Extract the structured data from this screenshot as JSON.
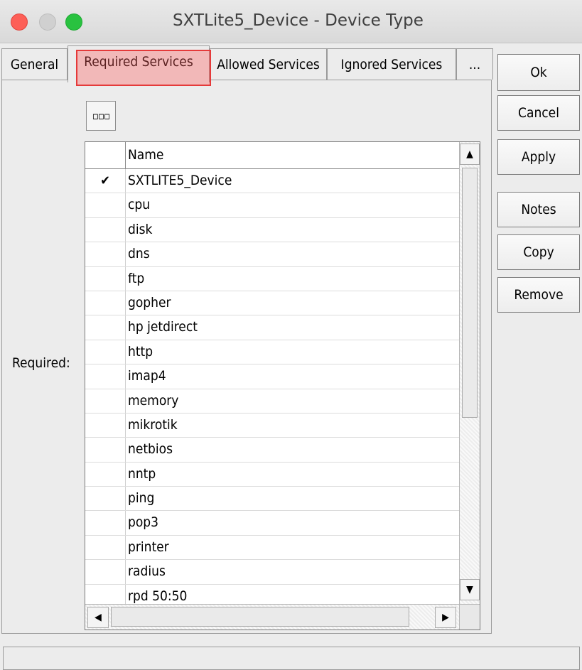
{
  "window": {
    "title": "SXTLite5_Device - Device Type"
  },
  "tabs": [
    {
      "label": "General"
    },
    {
      "label": "Required Services",
      "active": true
    },
    {
      "label": "Allowed Services"
    },
    {
      "label": "Ignored Services"
    },
    {
      "label": "..."
    }
  ],
  "toolbar": {
    "menu_button_label": "▫▫▫"
  },
  "form": {
    "required_label": "Required:"
  },
  "table": {
    "columns": [
      "",
      "Name"
    ],
    "rows": [
      {
        "checked": true,
        "check_glyph": "✔",
        "name": "SXTLITE5_Device"
      },
      {
        "checked": false,
        "check_glyph": "",
        "name": "cpu"
      },
      {
        "checked": false,
        "check_glyph": "",
        "name": "disk"
      },
      {
        "checked": false,
        "check_glyph": "",
        "name": "dns"
      },
      {
        "checked": false,
        "check_glyph": "",
        "name": "ftp"
      },
      {
        "checked": false,
        "check_glyph": "",
        "name": "gopher"
      },
      {
        "checked": false,
        "check_glyph": "",
        "name": "hp jetdirect"
      },
      {
        "checked": false,
        "check_glyph": "",
        "name": "http"
      },
      {
        "checked": false,
        "check_glyph": "",
        "name": "imap4"
      },
      {
        "checked": false,
        "check_glyph": "",
        "name": "memory"
      },
      {
        "checked": false,
        "check_glyph": "",
        "name": "mikrotik"
      },
      {
        "checked": false,
        "check_glyph": "",
        "name": "netbios"
      },
      {
        "checked": false,
        "check_glyph": "",
        "name": "nntp"
      },
      {
        "checked": false,
        "check_glyph": "",
        "name": "ping"
      },
      {
        "checked": false,
        "check_glyph": "",
        "name": "pop3"
      },
      {
        "checked": false,
        "check_glyph": "",
        "name": "printer"
      },
      {
        "checked": false,
        "check_glyph": "",
        "name": "radius"
      },
      {
        "checked": false,
        "check_glyph": "",
        "name": "rpd 50:50"
      }
    ]
  },
  "scroll": {
    "up_glyph": "▲",
    "down_glyph": "▼",
    "left_glyph": "◀",
    "right_glyph": "▶"
  },
  "buttons": {
    "ok": "Ok",
    "cancel": "Cancel",
    "apply": "Apply",
    "notes": "Notes",
    "copy": "Copy",
    "remove": "Remove"
  },
  "status": {
    "text": ""
  },
  "colors": {
    "close": "#fd5f57",
    "minimize": "#d0d0d0",
    "maximize": "#29c240",
    "highlight": "#e53a3a"
  }
}
